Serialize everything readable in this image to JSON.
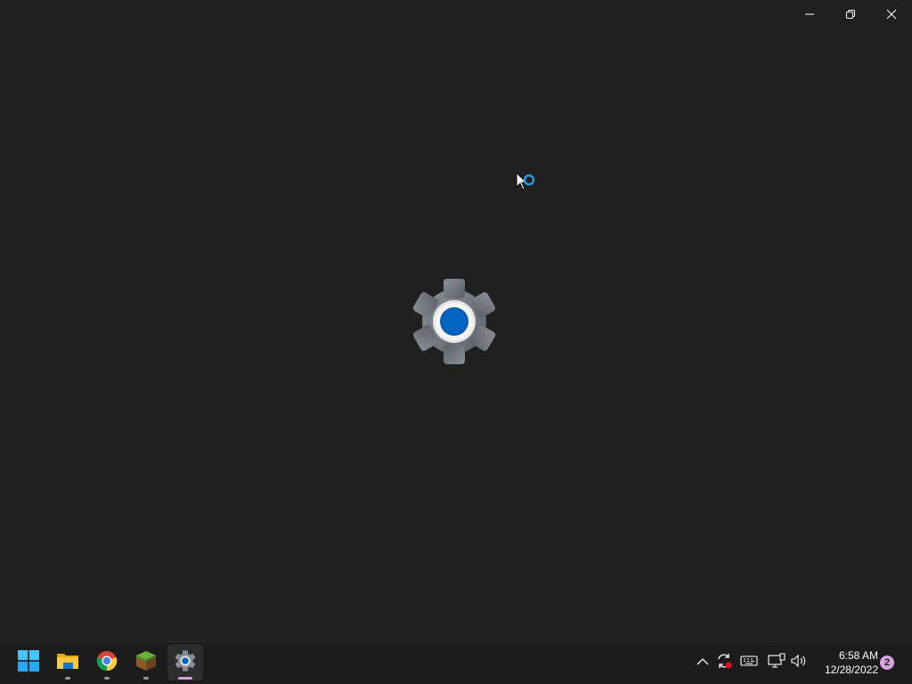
{
  "window": {
    "caption_buttons": {
      "minimize_icon": "minimize-icon",
      "restore_icon": "restore-icon",
      "close_icon": "close-icon"
    },
    "splash_icon": "settings-gear-icon"
  },
  "cursor": {
    "icon": "busy-cursor-icon"
  },
  "taskbar": {
    "apps": [
      {
        "icon": "windows-start-icon",
        "running": false,
        "active": false
      },
      {
        "icon": "file-explorer-icon",
        "running": true,
        "active": false
      },
      {
        "icon": "chrome-icon",
        "running": true,
        "active": false
      },
      {
        "icon": "minecraft-icon",
        "running": true,
        "active": false
      },
      {
        "icon": "settings-icon",
        "running": true,
        "active": true
      }
    ],
    "tray": {
      "icons": [
        "show-hidden-icons-chevron-icon",
        "sync-icon",
        "keyboard-icon",
        "network-icon",
        "volume-icon"
      ]
    },
    "clock": {
      "time": "6:58 AM",
      "date": "12/28/2022"
    },
    "notification_count": "2"
  },
  "colors": {
    "background": "#202020",
    "taskbar": "#1c1c1c",
    "accent": "#0067c0",
    "active_indicator": "#d69ad9",
    "badge": "#d7a3e0"
  }
}
